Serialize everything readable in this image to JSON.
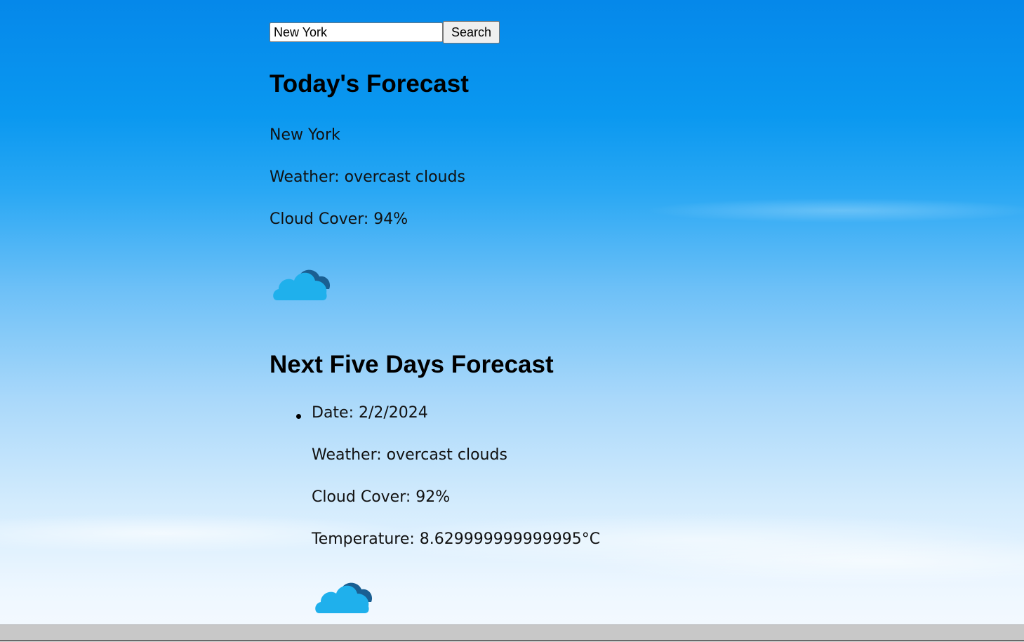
{
  "search": {
    "value": "New York",
    "button_label": "Search"
  },
  "today": {
    "heading": "Today's Forecast",
    "city": "New York",
    "weather": "Weather: overcast clouds",
    "cloud_cover": "Cloud Cover: 94%",
    "icon": "overcast-clouds-icon"
  },
  "five_days": {
    "heading": "Next Five Days Forecast",
    "items": [
      {
        "date": "Date: 2/2/2024",
        "weather": "Weather: overcast clouds",
        "cloud_cover": "Cloud Cover: 92%",
        "temperature": "Temperature: 8.629999999999995°C",
        "icon": "overcast-clouds-icon"
      }
    ]
  },
  "colors": {
    "sky_top": "#0588ea",
    "sky_bottom": "#f5faff",
    "cloud_front": "#1fb0ec",
    "cloud_back": "#1a5f92"
  }
}
